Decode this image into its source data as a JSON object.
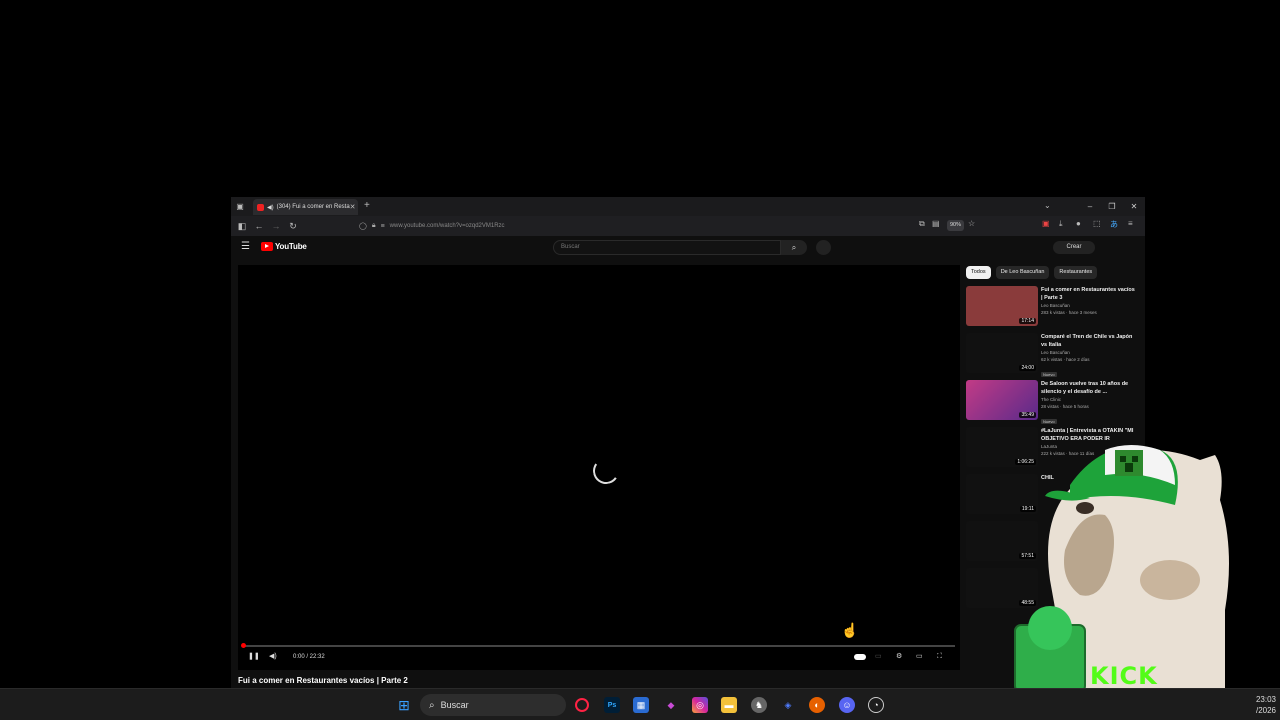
{
  "browser": {
    "tab_title": "(304) Fui a comer en Resta",
    "url": "www.youtube.com/watch?v=ozqd2VM1Rzc",
    "zoom": "90%"
  },
  "youtube": {
    "logo": "YouTube",
    "search_placeholder": "Buscar",
    "create_label": "Crear"
  },
  "player": {
    "time": "0:00 / 22:32",
    "video_title": "Fui a comer en Restaurantes vacíos | Parte 2",
    "progress_fraction": 0
  },
  "sidebar": {
    "chips": [
      {
        "label": "Todos",
        "active": true
      },
      {
        "label": "De Leo Bascuñan",
        "active": false
      },
      {
        "label": "Restaurantes",
        "active": false
      }
    ],
    "recommendations": [
      {
        "title": "Fui a comer en Restaurantes vacíos | Parte 3",
        "channel": "Leo Bascuñan",
        "meta": "283 k vistas · hace 3 meses",
        "duration": "17:14",
        "badge": ""
      },
      {
        "title": "Comparé el Tren de Chile vs Japón vs Italia",
        "channel": "Leo Bascuñan",
        "meta": "62 k vistas · hace 2 días",
        "duration": "24:00",
        "badge": "Nuevo"
      },
      {
        "title": "De Saloon vuelve tras 10 años de silencio y el desafío de ...",
        "channel": "The Clinic",
        "meta": "28 vistas · hace 5 horas",
        "duration": "35:49",
        "badge": "Nuevo"
      },
      {
        "title": "#LaJunta | Entrevista a OTAKIN \"MI OBJETIVO ERA PODER IR",
        "channel": "LaJunta",
        "meta": "222 k vistas · hace 11 días",
        "duration": "1:06:25",
        "badge": ""
      },
      {
        "title": "CHIL",
        "channel": "",
        "meta": "",
        "duration": "19:11",
        "badge": ""
      },
      {
        "title": "",
        "channel": "",
        "meta": "",
        "duration": "57:51",
        "badge": ""
      },
      {
        "title": "",
        "channel": "",
        "meta": "",
        "duration": "48:55",
        "badge": ""
      }
    ]
  },
  "overlay": {
    "kick_text": "KICK"
  },
  "taskbar": {
    "search_label": "Buscar",
    "time": "23:03",
    "date": "/2026"
  },
  "colors": {
    "youtube_red": "#ff0000",
    "kick_green": "#53fc18"
  }
}
